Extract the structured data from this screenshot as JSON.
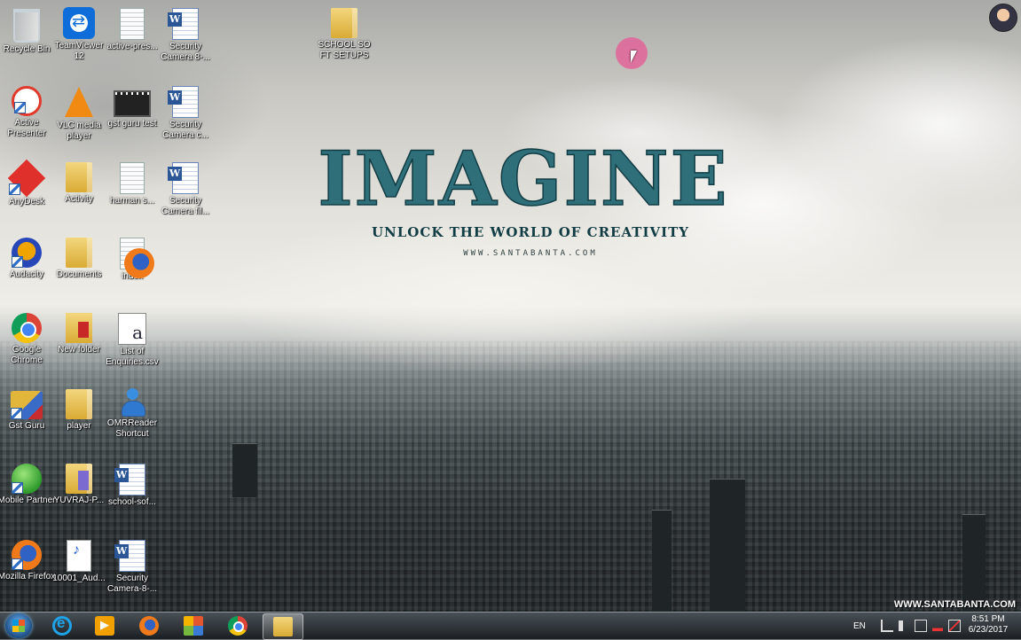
{
  "wallpaper": {
    "headline": "IMAGINE",
    "tagline": "UNLOCK THE WORLD OF CREATIVITY",
    "website": "WWW.SANTABANTA.COM",
    "watermark": "WWW.SANTABANTA.COM"
  },
  "desktop": {
    "icons": [
      {
        "label": "Recycle Bin",
        "icon": "recycle-bin-icon"
      },
      {
        "label": "TeamViewer 12",
        "icon": "teamviewer-icon"
      },
      {
        "label": "active-pres...",
        "icon": "text-file-icon"
      },
      {
        "label": "Security Camera 8-...",
        "icon": "word-document-icon"
      },
      {
        "label": "Active Presenter",
        "icon": "active-presenter-icon"
      },
      {
        "label": "VLC media player",
        "icon": "vlc-icon"
      },
      {
        "label": "gst guru test",
        "icon": "video-file-icon"
      },
      {
        "label": "Security Camera c...",
        "icon": "word-document-icon"
      },
      {
        "label": "AnyDesk",
        "icon": "anydesk-icon"
      },
      {
        "label": "Activity",
        "icon": "folder-icon"
      },
      {
        "label": "harman s...",
        "icon": "text-file-icon"
      },
      {
        "label": "Security Camera fil...",
        "icon": "word-document-icon"
      },
      {
        "label": "Audacity",
        "icon": "audacity-icon"
      },
      {
        "label": "Documents",
        "icon": "folder-icon"
      },
      {
        "label": "index",
        "icon": "firefox-html-icon"
      },
      {
        "label": "Google Chrome",
        "icon": "chrome-icon"
      },
      {
        "label": "New folder",
        "icon": "folder-icon"
      },
      {
        "label": "List of Enquiries.csv",
        "icon": "csv-file-icon"
      },
      {
        "label": "Gst Guru",
        "icon": "gst-guru-icon"
      },
      {
        "label": "player",
        "icon": "folder-icon"
      },
      {
        "label": "OMRReader Shortcut",
        "icon": "omr-reader-icon"
      },
      {
        "label": "Mobile Partner",
        "icon": "mobile-partner-icon"
      },
      {
        "label": "YUVRAJ-P...",
        "icon": "folder-icon"
      },
      {
        "label": "school-sof...",
        "icon": "word-document-icon"
      },
      {
        "label": "Mozilla Firefox",
        "icon": "firefox-icon"
      },
      {
        "label": "10001_Aud...",
        "icon": "wav-file-icon"
      },
      {
        "label": "Security Camera-8-...",
        "icon": "word-document-icon"
      },
      {
        "label": "SCHOOL SO FT SETUPS",
        "icon": "folder-icon"
      }
    ]
  },
  "taskbar": {
    "pinned": [
      {
        "name": "internet-explorer-icon"
      },
      {
        "name": "media-player-icon"
      },
      {
        "name": "firefox-icon"
      },
      {
        "name": "office-icon"
      },
      {
        "name": "chrome-icon"
      },
      {
        "name": "file-explorer-icon"
      }
    ],
    "language": "EN",
    "time": "8:51 PM",
    "date": "6/23/2017"
  }
}
